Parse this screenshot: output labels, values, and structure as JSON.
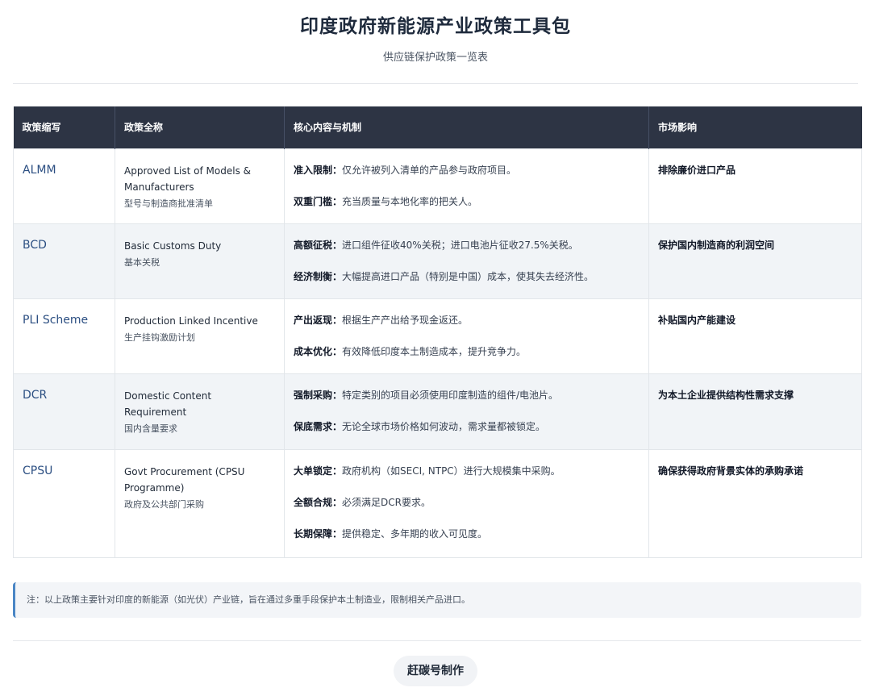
{
  "header": {
    "title": "印度政府新能源产业政策工具包",
    "subtitle": "供应链保护政策一览表"
  },
  "table": {
    "columns": [
      "政策缩写",
      "政策全称",
      "核心内容与机制",
      "市场影响"
    ],
    "rows": [
      {
        "abbr": "ALMM",
        "full_en": "Approved List of Models & Manufacturers",
        "full_cn": "型号与制造商批准清单",
        "mechanisms": [
          {
            "key": "准入限制：",
            "text": "仅允许被列入清单的产品参与政府项目。"
          },
          {
            "key": "双重门槛：",
            "text": "充当质量与本地化率的把关人。"
          }
        ],
        "impact": "排除廉价进口产品"
      },
      {
        "abbr": "BCD",
        "full_en": "Basic Customs Duty",
        "full_cn": "基本关税",
        "mechanisms": [
          {
            "key": "高额征税：",
            "text": "进口组件征收40%关税；进口电池片征收27.5%关税。"
          },
          {
            "key": "经济制衡：",
            "text": "大幅提高进口产品（特别是中国）成本，使其失去经济性。"
          }
        ],
        "impact": "保护国内制造商的利润空间"
      },
      {
        "abbr": "PLI Scheme",
        "full_en": "Production Linked Incentive",
        "full_cn": "生产挂钩激励计划",
        "mechanisms": [
          {
            "key": "产出返现：",
            "text": "根据生产产出给予现金返还。"
          },
          {
            "key": "成本优化：",
            "text": "有效降低印度本土制造成本，提升竞争力。"
          }
        ],
        "impact": "补贴国内产能建设"
      },
      {
        "abbr": "DCR",
        "full_en": "Domestic Content Requirement",
        "full_cn": "国内含量要求",
        "mechanisms": [
          {
            "key": "强制采购：",
            "text": "特定类别的项目必须使用印度制造的组件/电池片。"
          },
          {
            "key": "保底需求：",
            "text": "无论全球市场价格如何波动，需求量都被锁定。"
          }
        ],
        "impact": "为本土企业提供结构性需求支撑"
      },
      {
        "abbr": "CPSU",
        "full_en": "Govt Procurement (CPSU Programme)",
        "full_cn": "政府及公共部门采购",
        "mechanisms": [
          {
            "key": "大单锁定：",
            "text": "政府机构（如SECI, NTPC）进行大规模集中采购。"
          },
          {
            "key": "全额合规：",
            "text": "必须满足DCR要求。"
          },
          {
            "key": "长期保障：",
            "text": "提供稳定、多年期的收入可见度。"
          }
        ],
        "impact": "确保获得政府背景实体的承购承诺"
      }
    ]
  },
  "note": "注：以上政策主要针对印度的新能源（如光伏）产业链，旨在通过多重手段保护本土制造业，限制相关产品进口。",
  "footer": {
    "brand": "赶碳号制作"
  },
  "colors": {
    "header_bg": "#2d3444",
    "abbr_text": "#2c4f82",
    "note_accent": "#4a86c5",
    "alt_row_bg": "#f1f4f7"
  }
}
